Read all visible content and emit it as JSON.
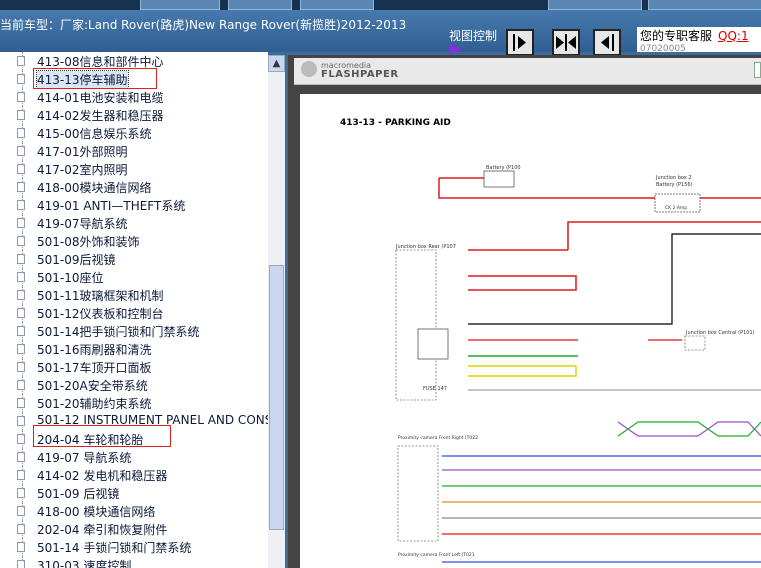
{
  "header": {
    "vehicle_info": "当前车型：厂家:Land Rover(路虎)New Range Rover(新揽胜)2012-2013",
    "view_control": "视图控制",
    "support_label": "您的专职客服",
    "qq_label": "QQ:1",
    "phone_partial": "07020005"
  },
  "tree": {
    "items": [
      {
        "label": "413-08信息和部件中心"
      },
      {
        "label": "413-13停车辅助"
      },
      {
        "label": "414-01电池安装和电缆"
      },
      {
        "label": "414-02发生器和稳压器"
      },
      {
        "label": "415-00信息娱乐系统"
      },
      {
        "label": "417-01外部照明"
      },
      {
        "label": "417-02室内照明"
      },
      {
        "label": "418-00模块通信网络"
      },
      {
        "label": "419-01 ANTI—THEFT系统"
      },
      {
        "label": "419-07导航系统"
      },
      {
        "label": "501-08外饰和装饰"
      },
      {
        "label": "501-09后视镜"
      },
      {
        "label": "501-10座位"
      },
      {
        "label": "501-11玻璃框架和机制"
      },
      {
        "label": "501-12仪表板和控制台"
      },
      {
        "label": "501-14把手锁闩锁和门禁系统"
      },
      {
        "label": "501-16雨刷器和清洗"
      },
      {
        "label": "501-17车顶开口面板"
      },
      {
        "label": "501-20A安全带系统"
      },
      {
        "label": "501-20辅助约束系统"
      },
      {
        "label": "501-12 INSTRUMENT PANEL AND CONS"
      },
      {
        "label": "204-04 车轮和轮胎"
      },
      {
        "label": "419-07 导航系统"
      },
      {
        "label": "414-02 发电机和稳压器"
      },
      {
        "label": "501-09 后视镜"
      },
      {
        "label": "418-00 模块通信网络"
      },
      {
        "label": "202-04 牵引和恢复附件"
      },
      {
        "label": "501-14 手锁闩锁和门禁系统"
      },
      {
        "label": "310-03 速度控制"
      }
    ]
  },
  "viewer": {
    "brand_small": "macromedia",
    "brand_big": "FLASHPAPER",
    "page_title": "413-13 - PARKING AID",
    "labels": {
      "battery": "Battery (P100",
      "junction2": "Junction box 2",
      "junction2b": "Battery (P156)",
      "fuse": "CK 2 Amp",
      "jbrear": "Junction box Rear (P107",
      "jbcentral": "Junction box Central (P101)",
      "fuse2": "FUSE 147",
      "reverse": "Proximity camera Front Right (T022",
      "reverse2": "Proximity camera Front Left (T021"
    }
  },
  "colors": {
    "red": "#e01818",
    "black": "#000000",
    "green": "#1fae2a",
    "yellow": "#e0d000",
    "purple": "#9b4fc8",
    "blue": "#2a4fd6",
    "orange": "#e08a20",
    "gray": "#8a8a8a"
  }
}
